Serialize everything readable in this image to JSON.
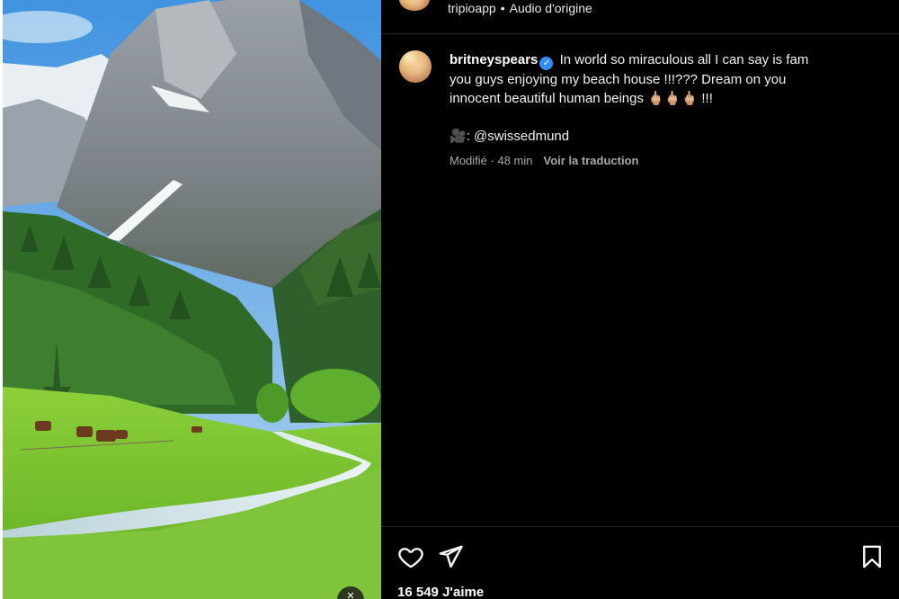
{
  "header": {
    "account": "tripioapp",
    "separator": "•",
    "audio": "Audio d'origine"
  },
  "post": {
    "username": "britneyspears",
    "verified_mark": "✓",
    "caption_line1": "In world so miraculous all I can say is fam",
    "caption_line2": "you guys enjoying my beach house !!!??? Dream on you",
    "caption_line3": "innocent beautiful human beings",
    "caption_emojis": "🖕🏼🖕🏼🖕🏼",
    "caption_end": " !!!",
    "credit_icon": "🎥",
    "credit_text": ": @swissedmund",
    "edited_label": "Modifié",
    "edited_sep": " · ",
    "time_ago": "48 min",
    "translate_label": "Voir la traduction"
  },
  "actions": {
    "like_icon": "heart-icon",
    "share_icon": "paper-plane-icon",
    "save_icon": "bookmark-icon",
    "likes_count": "16 549",
    "likes_label": "J'aime"
  },
  "media": {
    "description_icons": [
      "mute-icon"
    ]
  },
  "colors": {
    "background": "#000000",
    "verified": "#2f8ff7",
    "muted_text": "#a8a8a8",
    "divider": "#262626"
  }
}
